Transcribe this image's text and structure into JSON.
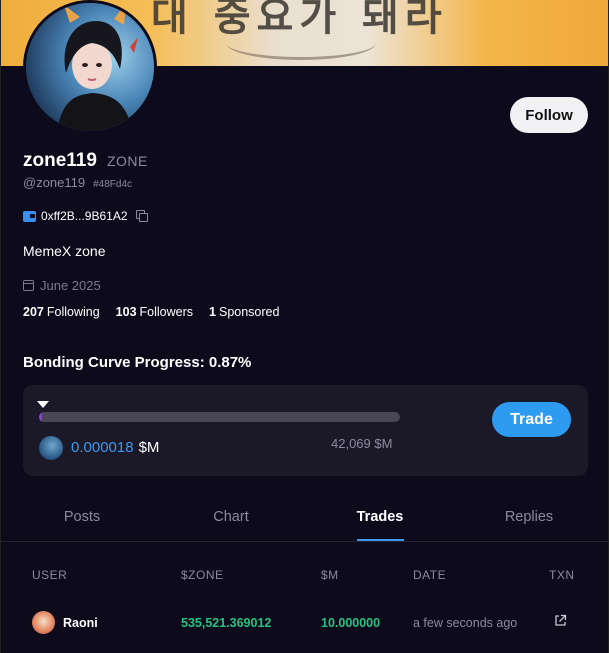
{
  "profile": {
    "display_name": "zone119",
    "ticker": "ZONE",
    "handle": "@zone119",
    "hash": "#48Fd4c",
    "wallet": "0xff2B...9B61A2",
    "bio": "MemeX zone",
    "joined": "June 2025",
    "follow_label": "Follow",
    "banner_text": "대 중요가 돼라"
  },
  "stats": {
    "following_count": "207",
    "following_label": "Following",
    "followers_count": "103",
    "followers_label": "Followers",
    "sponsored_count": "1",
    "sponsored_label": "Sponsored"
  },
  "bonding": {
    "title": "Bonding Curve Progress: 0.87%",
    "progress_percent": 0.87,
    "price": "0.000018",
    "price_unit": "$M",
    "market_cap": "42,069 $M",
    "trade_label": "Trade"
  },
  "tabs": [
    {
      "label": "Posts",
      "active": false
    },
    {
      "label": "Chart",
      "active": false
    },
    {
      "label": "Trades",
      "active": true
    },
    {
      "label": "Replies",
      "active": false
    }
  ],
  "trades_table": {
    "headers": [
      "USER",
      "$ZONE",
      "$M",
      "DATE",
      "TXN"
    ],
    "rows": [
      {
        "user": "Raoni",
        "zone": "535,521.369012",
        "m": "10.000000",
        "date": "a few seconds ago"
      }
    ]
  },
  "colors": {
    "background": "#0d0a1c",
    "accent": "#2c9bf0",
    "progress": "#8a3fd8",
    "positive": "#26c281"
  },
  "icons": [
    "wallet-icon",
    "copy-icon",
    "calendar-icon",
    "external-link-icon"
  ]
}
